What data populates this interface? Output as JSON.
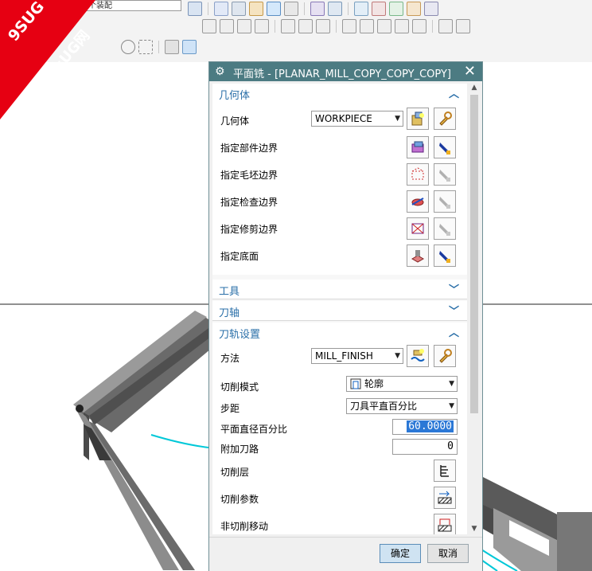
{
  "watermark": {
    "line1": "9SUG",
    "line2": "学UG就上UG网"
  },
  "toolbar": {
    "filter_select": "整个装配",
    "icons": [
      "select-icon",
      "layer-icon",
      "view-icon",
      "shade-icon",
      "snap-icon",
      "measure-icon",
      "point-icon",
      "line-icon",
      "arc-icon",
      "tool-icon"
    ]
  },
  "dialog": {
    "title": "平面铣 - [PLANAR_MILL_COPY_COPY_COPY]",
    "sections": {
      "geometry": {
        "title": "几何体",
        "expanded": true
      },
      "tool": {
        "title": "工具",
        "expanded": false
      },
      "axis": {
        "title": "刀轴",
        "expanded": false
      },
      "path": {
        "title": "刀轨设置",
        "expanded": true
      }
    },
    "geometry": {
      "geometry_label": "几何体",
      "geometry_value": "WORKPIECE",
      "part_boundary": "指定部件边界",
      "blank_boundary": "指定毛坯边界",
      "check_boundary": "指定检查边界",
      "trim_boundary": "指定修剪边界",
      "floor": "指定底面"
    },
    "path": {
      "method_label": "方法",
      "method_value": "MILL_FINISH",
      "cut_pattern_label": "切削模式",
      "cut_pattern_value": "轮廓",
      "stepover_label": "步距",
      "stepover_value": "刀具平直百分比",
      "flat_diameter_label": "平面直径百分比",
      "flat_diameter_value": "60.0000",
      "extra_passes_label": "附加刀路",
      "extra_passes_value": "0",
      "cut_levels_label": "切削层",
      "cut_params_label": "切削参数",
      "non_cut_moves_label": "非切削移动"
    },
    "buttons": {
      "ok": "确定",
      "cancel": "取消"
    }
  },
  "colors": {
    "title_bar": "#4c7b82",
    "section_text": "#2a6fa8",
    "selection": "#2b78d6",
    "part": "#5a5a5a",
    "toolpath": "#00c8d8"
  }
}
